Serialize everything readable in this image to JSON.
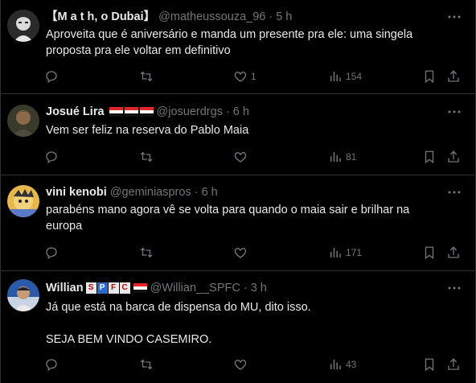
{
  "tweets": [
    {
      "name": "【M a t h, o Dubai】",
      "handle": "@matheussouza_96",
      "time": "5 h",
      "text": [
        "Aproveita que é aniversário e manda um presente pra ele: uma singela",
        "proposta pra ele voltar em definitivo"
      ],
      "likes": "1",
      "views": "154"
    },
    {
      "name": "Josué Lira",
      "handle": "@josuerdrgs",
      "time": "6 h",
      "text": [
        "Vem ser feliz na reserva do Pablo Maia"
      ],
      "likes": "",
      "views": "81"
    },
    {
      "name": "vini kenobi",
      "handle": "@geminiaspros",
      "time": "6 h",
      "text": [
        "parabéns mano agora vê se volta para quando o maia sair e brilhar na",
        "europa"
      ],
      "likes": "",
      "views": "171"
    },
    {
      "name": "Willian",
      "name_badge": [
        "S",
        "P",
        "F",
        "C"
      ],
      "handle": "@Willian__SPFC",
      "time": "3 h",
      "text": [
        "Já que está na barca de dispensa do MU, dito isso.",
        "",
        "SEJA BEM VINDO CASEMIRO."
      ],
      "likes": "",
      "views": "43"
    }
  ],
  "separator": "·",
  "icons": [
    "reply-icon",
    "retweet-icon",
    "like-icon",
    "views-icon",
    "bookmark-icon",
    "share-icon",
    "more-icon"
  ],
  "colors": {
    "background": "#000000",
    "text": "#e7e9ea",
    "muted": "#71767b",
    "border": "#2f3336"
  }
}
